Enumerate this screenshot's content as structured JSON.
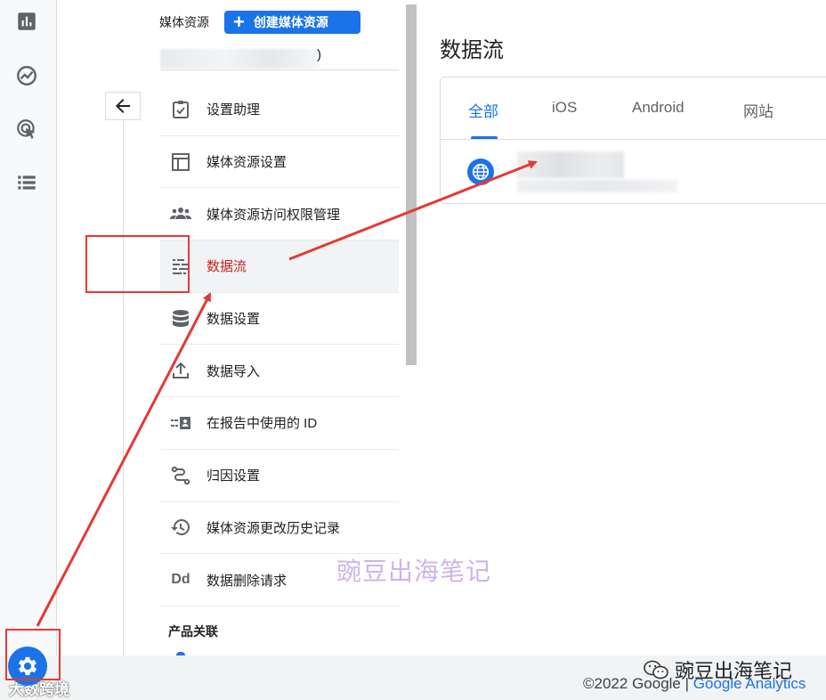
{
  "colors": {
    "accent": "#1a73e8",
    "annotation": "#e53935",
    "active_text": "#c5221f",
    "watermark": "#cdb4ea"
  },
  "rail": {
    "icons": [
      "reports-icon",
      "explore-icon",
      "advertising-icon",
      "configure-icon"
    ],
    "admin_icon": "gear-icon"
  },
  "panel": {
    "property_label": "媒体资源",
    "create_button": "创建媒体资源",
    "property_name_tail": ")",
    "menu_items": [
      {
        "label": "设置助理",
        "icon": "setup-assistant-icon"
      },
      {
        "label": "媒体资源设置",
        "icon": "property-settings-icon"
      },
      {
        "label": "媒体资源访问权限管理",
        "icon": "people-icon"
      },
      {
        "label": "数据流",
        "icon": "data-streams-icon"
      },
      {
        "label": "数据设置",
        "icon": "database-icon"
      },
      {
        "label": "数据导入",
        "icon": "upload-icon"
      },
      {
        "label": "在报告中使用的 ID",
        "icon": "reporting-identity-icon"
      },
      {
        "label": "归因设置",
        "icon": "attribution-icon"
      },
      {
        "label": "媒体资源更改历史记录",
        "icon": "history-icon"
      },
      {
        "label": "数据删除请求",
        "icon": "dd-icon"
      }
    ],
    "active_index": 3,
    "dd_glyph": "Dd",
    "section_label": "产品关联"
  },
  "content": {
    "page_title": "数据流",
    "tabs": [
      "全部",
      "iOS",
      "Android",
      "网站"
    ],
    "active_tab": 0
  },
  "watermark": "豌豆出海笔记",
  "footer": {
    "wechat_label": "豌豆出海笔记",
    "copyright": "©2022 Google",
    "separator": "|",
    "analytics": "Google Analytics",
    "corner_brand": "大数跨境"
  }
}
